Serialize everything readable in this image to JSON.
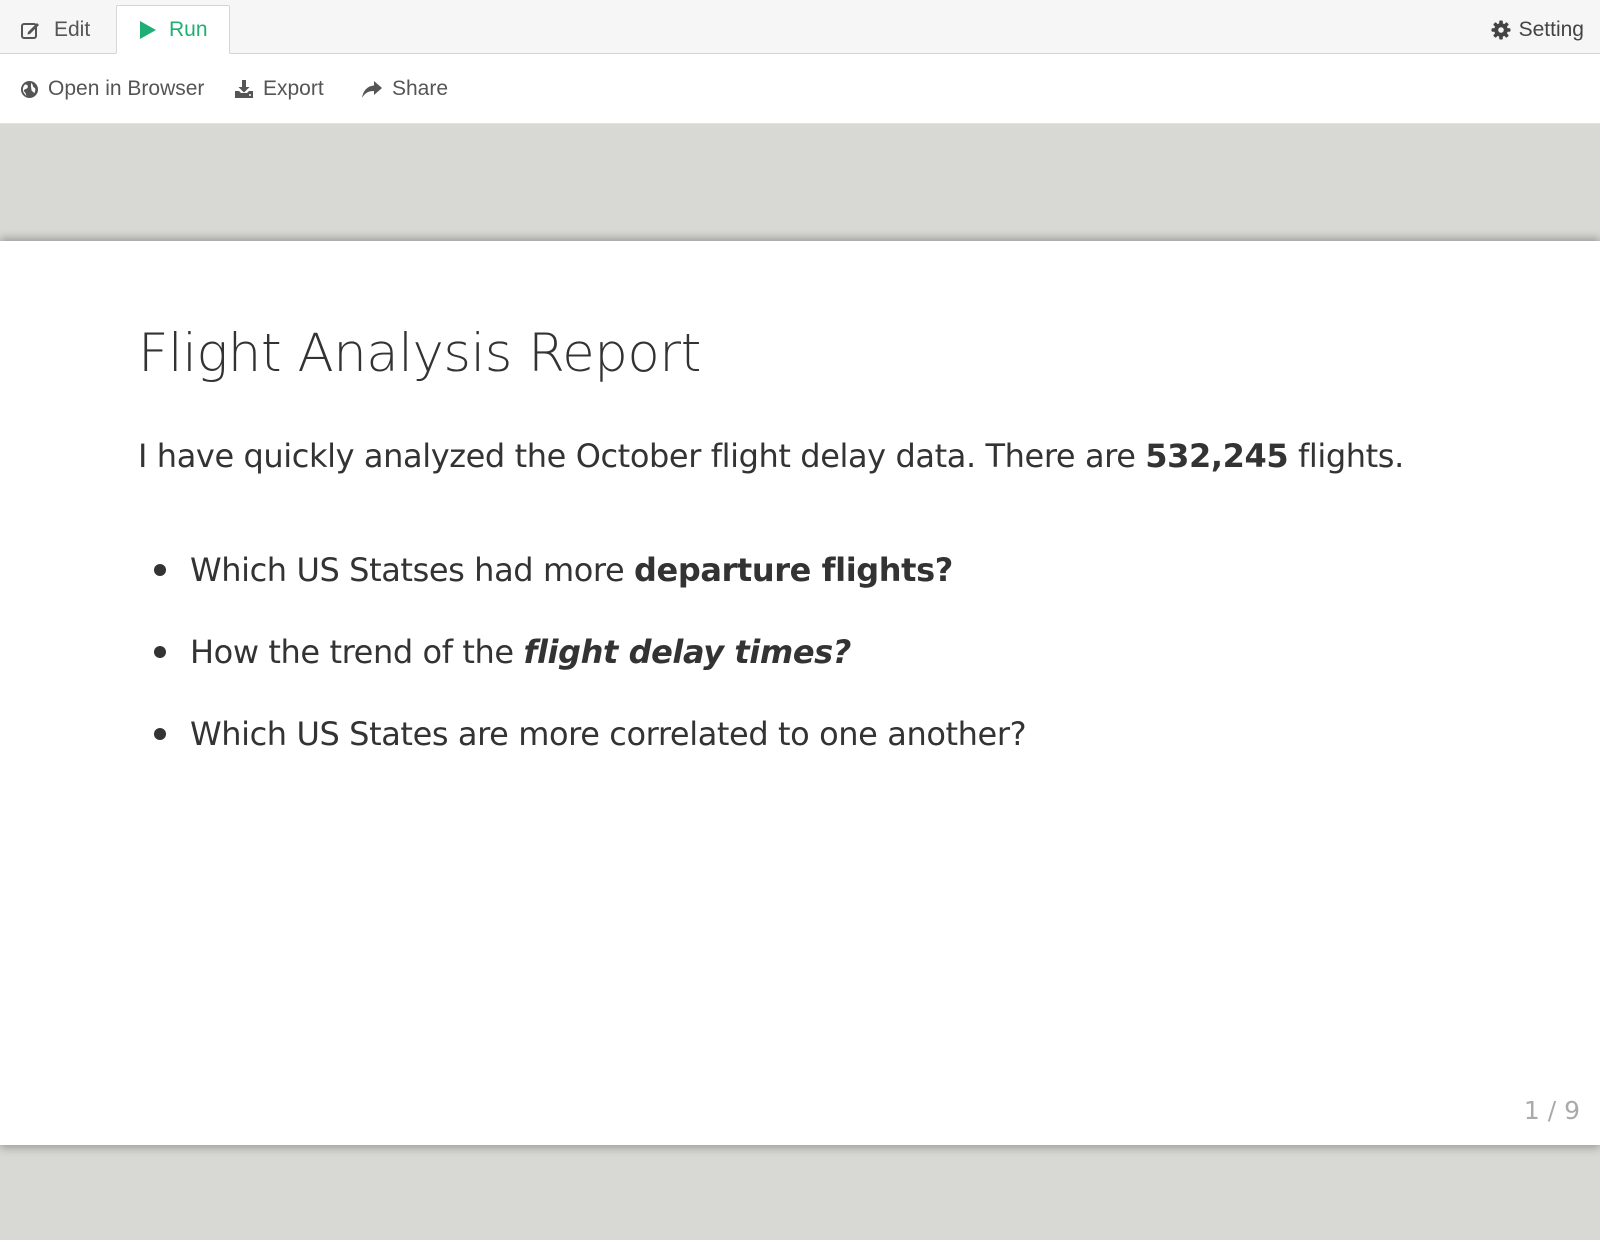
{
  "tabs": {
    "edit_label": "Edit",
    "run_label": "Run",
    "setting_label": "Setting"
  },
  "toolbar": {
    "open_in_browser_label": "Open in Browser",
    "export_label": "Export",
    "share_label": "Share"
  },
  "slide": {
    "title": "Flight Analysis Report",
    "lead_prefix": "I have quickly analyzed the October flight delay data. There are ",
    "lead_count": "532,245",
    "lead_suffix": " flights.",
    "bullets": [
      {
        "text": "Which US Statses had more ",
        "emphasis": "departure flights?"
      },
      {
        "text": "How the trend of the ",
        "emphasis": "flight delay times?"
      },
      {
        "text": "Which US States are more correlated to one another?"
      }
    ],
    "page_indicator": "1 / 9"
  },
  "colors": {
    "accent": "#1fae75",
    "text": "#333333",
    "stage": "#d8d9d4"
  },
  "icons": {
    "edit": "edit-icon",
    "run": "play-icon",
    "setting": "gear-icon",
    "browser": "globe-icon",
    "export": "download-icon",
    "share": "share-icon"
  }
}
